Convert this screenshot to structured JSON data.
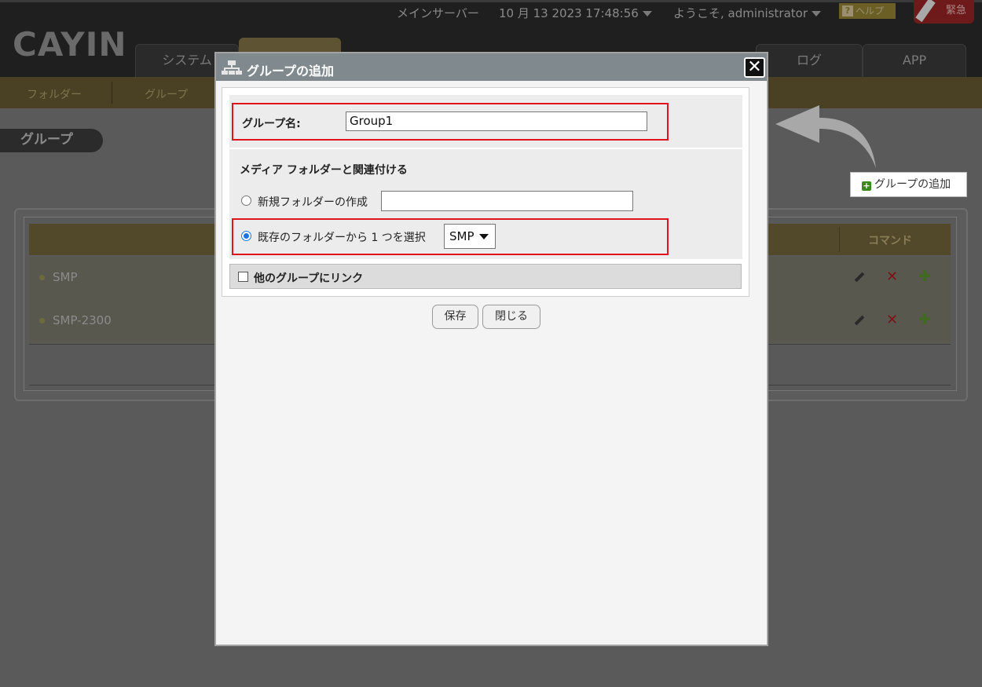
{
  "header": {
    "server": "メインサーバー",
    "datetime": "10 月 13 2023 17:48:56",
    "welcome": "ようこそ, administrator",
    "help_label": "ヘルプ",
    "emergency_label": "緊急",
    "logo": "CAYIN"
  },
  "nav": {
    "tabs": [
      {
        "label": "システム"
      },
      {
        "label": "ログ"
      },
      {
        "label": "APP"
      }
    ]
  },
  "subnav": {
    "items": [
      {
        "label": "フォルダー"
      },
      {
        "label": "グループ"
      }
    ]
  },
  "page": {
    "section_label": "グループ",
    "add_group_button": "グループの追加",
    "table": {
      "command_header": "コマンド",
      "rows": [
        {
          "name": "SMP"
        },
        {
          "name": "SMP-2300"
        }
      ]
    }
  },
  "modal": {
    "title": "グループの追加",
    "group_name_label": "グループ名:",
    "group_name_value": "Group1",
    "media_folder_label": "メディア フォルダーと関連付ける",
    "new_folder_label": "新規フォルダーの作成",
    "new_folder_value": "",
    "existing_folder_label": "既存のフォルダーから 1 つを選択",
    "existing_folder_selected": "SMP",
    "link_other_label": "他のグループにリンク",
    "save_label": "保存",
    "close_label": "閉じる"
  },
  "colors": {
    "highlight": "#e0141a",
    "modal_title_bg": "#808a8e",
    "accent_gold": "#5e5433"
  }
}
